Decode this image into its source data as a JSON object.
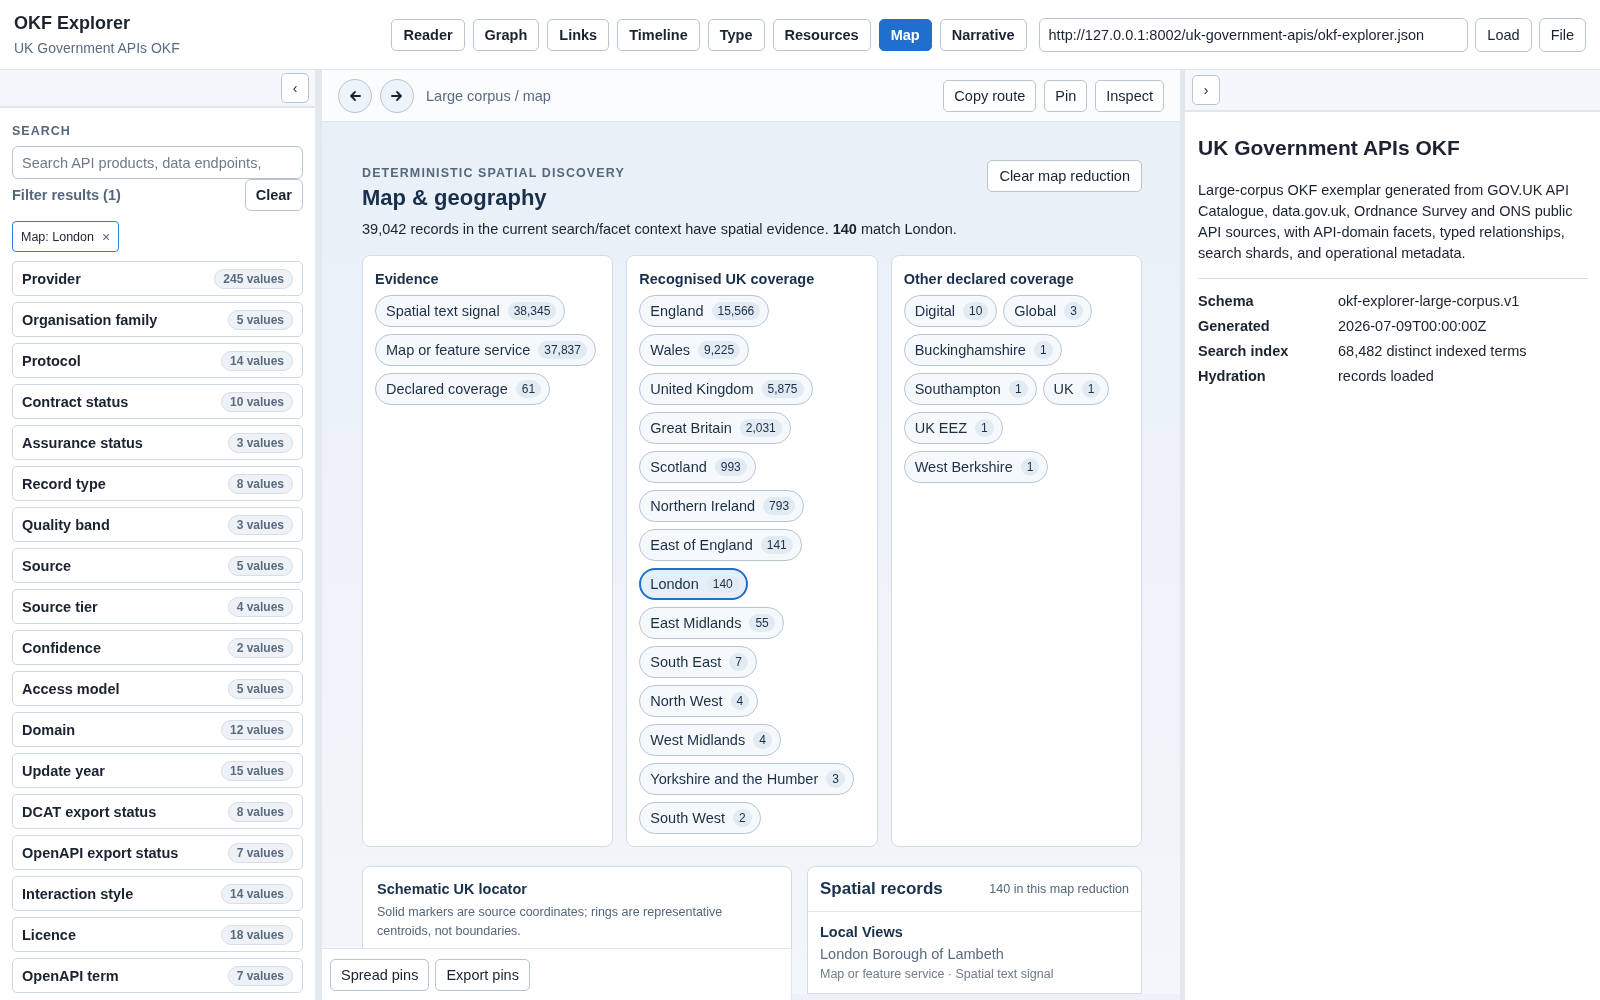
{
  "app": {
    "title": "OKF Explorer",
    "subtitle": "UK Government APIs OKF"
  },
  "views": [
    {
      "label": "Reader",
      "selected": false
    },
    {
      "label": "Graph",
      "selected": false
    },
    {
      "label": "Links",
      "selected": false
    },
    {
      "label": "Timeline",
      "selected": false
    },
    {
      "label": "Type",
      "selected": false
    },
    {
      "label": "Resources",
      "selected": false
    },
    {
      "label": "Map",
      "selected": true
    },
    {
      "label": "Narrative",
      "selected": false
    }
  ],
  "source": {
    "url": "http://127.0.0.1:8002/uk-government-apis/okf-explorer.json",
    "buttons": [
      "Load",
      "File"
    ]
  },
  "sidebar": {
    "collapse": "‹",
    "search_label": "SEARCH",
    "search": {
      "placeholder": "Search API products, data endpoints,"
    },
    "filter_title": "Filter results (1)",
    "clear": "Clear",
    "active_filters": [
      {
        "label": "Map: London",
        "remove": "×"
      }
    ],
    "facets": [
      {
        "name": "Provider",
        "count": "245 values"
      },
      {
        "name": "Organisation family",
        "count": "5 values"
      },
      {
        "name": "Protocol",
        "count": "14 values"
      },
      {
        "name": "Contract status",
        "count": "10 values"
      },
      {
        "name": "Assurance status",
        "count": "3 values"
      },
      {
        "name": "Record type",
        "count": "8 values"
      },
      {
        "name": "Quality band",
        "count": "3 values"
      },
      {
        "name": "Source",
        "count": "5 values"
      },
      {
        "name": "Source tier",
        "count": "4 values"
      },
      {
        "name": "Confidence",
        "count": "2 values"
      },
      {
        "name": "Access model",
        "count": "5 values"
      },
      {
        "name": "Domain",
        "count": "12 values"
      },
      {
        "name": "Update year",
        "count": "15 values"
      },
      {
        "name": "DCAT export status",
        "count": "8 values"
      },
      {
        "name": "OpenAPI export status",
        "count": "7 values"
      },
      {
        "name": "Interaction style",
        "count": "14 values"
      },
      {
        "name": "Licence",
        "count": "18 values"
      },
      {
        "name": "OpenAPI term",
        "count": "7 values"
      }
    ]
  },
  "main": {
    "breadcrumb": "Large corpus / map",
    "actions": [
      "Copy route",
      "Pin",
      "Inspect"
    ],
    "eyebrow": "DETERMINISTIC SPATIAL DISCOVERY",
    "title": "Map & geography",
    "summary": "39,042 records in the current search/facet context have spatial evidence. **140** match London.",
    "clear": "Clear map reduction",
    "groups": [
      {
        "title": "Evidence",
        "chips": [
          {
            "label": "Spatial text signal",
            "count": "38,345",
            "selected": false
          },
          {
            "label": "Map or feature service",
            "count": "37,837",
            "selected": false
          },
          {
            "label": "Declared coverage",
            "count": "61",
            "selected": false
          }
        ]
      },
      {
        "title": "Recognised UK coverage",
        "chips": [
          {
            "label": "England",
            "count": "15,566",
            "selected": false
          },
          {
            "label": "Wales",
            "count": "9,225",
            "selected": false
          },
          {
            "label": "United Kingdom",
            "count": "5,875",
            "selected": false
          },
          {
            "label": "Great Britain",
            "count": "2,031",
            "selected": false
          },
          {
            "label": "Scotland",
            "count": "993",
            "selected": false
          },
          {
            "label": "Northern Ireland",
            "count": "793",
            "selected": false
          },
          {
            "label": "East of England",
            "count": "141",
            "selected": false
          },
          {
            "label": "London",
            "count": "140",
            "selected": true
          },
          {
            "label": "East Midlands",
            "count": "55",
            "selected": false
          },
          {
            "label": "South East",
            "count": "7",
            "selected": false
          },
          {
            "label": "North West",
            "count": "4",
            "selected": false
          },
          {
            "label": "West Midlands",
            "count": "4",
            "selected": false
          },
          {
            "label": "Yorkshire and the Humber",
            "count": "3",
            "selected": false
          },
          {
            "label": "South West",
            "count": "2",
            "selected": false
          }
        ]
      },
      {
        "title": "Other declared coverage",
        "chips": [
          {
            "label": "Digital",
            "count": "10",
            "selected": false
          },
          {
            "label": "Global",
            "count": "3",
            "selected": false
          },
          {
            "label": "Buckinghamshire",
            "count": "1",
            "selected": false
          },
          {
            "label": "Southampton",
            "count": "1",
            "selected": false
          },
          {
            "label": "UK",
            "count": "1",
            "selected": false
          },
          {
            "label": "UK EEZ",
            "count": "1",
            "selected": false
          },
          {
            "label": "West Berkshire",
            "count": "1",
            "selected": false
          }
        ]
      }
    ],
    "locator": {
      "title": "Schematic UK locator",
      "note": "Solid markers are source coordinates; rings are representative centroids, not boundaries."
    },
    "records": {
      "title": "Spatial records",
      "count": "140 in this map reduction",
      "group": "Local Views",
      "items": [
        {
          "title": "London Borough of Lambeth",
          "meta": "Map or feature service · Spatial text signal"
        }
      ]
    },
    "pin_actions": [
      "Spread pins",
      "Export pins"
    ]
  },
  "details": {
    "expand": "›",
    "title": "UK Government APIs OKF",
    "description": "Large-corpus OKF exemplar generated from GOV.UK API Catalogue, data.gov.uk, Ordnance Survey and ONS public API sources, with API-domain facets, typed relationships, search shards, and operational metadata.",
    "fields": [
      {
        "label": "Schema",
        "value": "okf-explorer-large-corpus.v1"
      },
      {
        "label": "Generated",
        "value": "2026-07-09T00:00:00Z"
      },
      {
        "label": "Search index",
        "value": "68,482 distinct indexed terms"
      },
      {
        "label": "Hydration",
        "value": "records loaded"
      }
    ]
  }
}
